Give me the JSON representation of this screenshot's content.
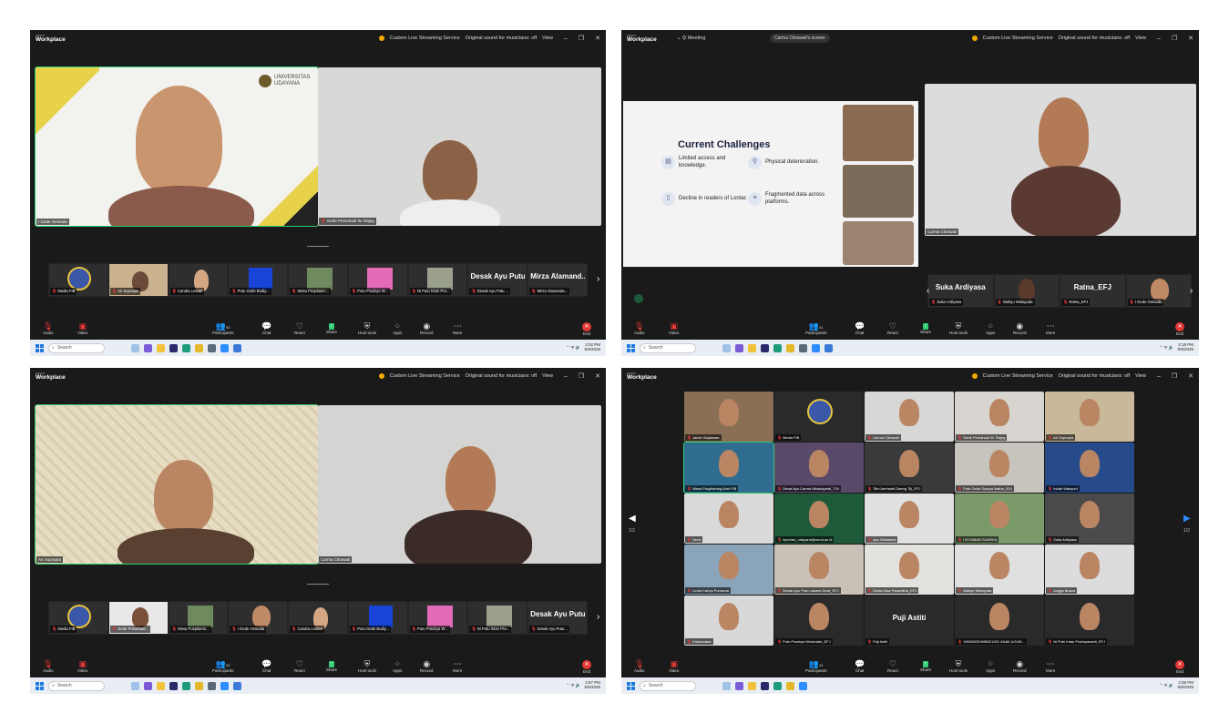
{
  "zoom": {
    "brand_small": "zoom",
    "brand": "Workplace"
  },
  "titlebar": {
    "streaming": "Custom Live Streaming Service",
    "sound": "Original sound for musicians: off",
    "view": "View",
    "meeting": "Meeting",
    "screen_share": "Carma Citrawati's screen"
  },
  "controls": {
    "audio": "Audio",
    "video": "Video",
    "participants": "Participants",
    "participants_count_1": "52",
    "participants_count_2": "41",
    "participants_count_3": "52",
    "participants_count_4": "41",
    "chat": "Chat",
    "react": "React",
    "share": "Share",
    "host_tools": "Host tools",
    "apps": "Apps",
    "record": "Record",
    "more": "More",
    "end": "End"
  },
  "taskbar": {
    "search": "Search"
  },
  "s1": {
    "speaker1": "I Gede Oeinada",
    "speaker2": "Gede Primahadi W. Rajeg",
    "logo_text": "UNIVERSITAS UDAYANA",
    "thumbs": [
      "Media FIB",
      "Ari Suprapta",
      "Candra Lestari",
      "Putu Gede Budiy...",
      "Nissa Puspitanin...",
      "Putu Pradnya W...",
      "Ni Putu Intan Pra...",
      "Desak Ayu Putu ...",
      "Mirza Alamanda..."
    ],
    "big1": "Desak Ayu Putu...",
    "big2": "Mirza Alamand...",
    "time": "2:02 PM",
    "date": "5/9/2025"
  },
  "s2": {
    "slide_title": "Current Challenges",
    "challenges": [
      "Limited access and knowledge.",
      "Physical deterioration.",
      "Decline in readers of Lontar.",
      "Fragmented data across platforms."
    ],
    "speaker": "Carma Citrawati",
    "strip_names": [
      "Suka Ardiyasa",
      "Wahyu Widayuda",
      "Ratna_EFJ",
      "I Gede Oeinada"
    ],
    "big1": "Suka Ardiyasa",
    "big2": "Ratna_EFJ",
    "time": "2:19 PM",
    "date": "5/9/2025"
  },
  "s3": {
    "speaker1": "Ari Suprapta",
    "speaker2": "Carma Citrawati",
    "thumbs": [
      "Media FIB",
      "Gede Primahadi...",
      "Nissa Puspitanin...",
      "I Gede Oeinada",
      "Candra Lestari",
      "Putu Gede Budiy...",
      "Putu Pradnya W...",
      "Ni Putu Intan Pra...",
      "Desak Ayu Putu..."
    ],
    "big": "Desak Ayu Putu...",
    "time": "2:57 PM",
    "date": "5/9/2025"
  },
  "s4": {
    "gallery": [
      "Jamin Saptawan",
      "Media FIB",
      "Carma Citrawati",
      "Gede Primahadi W. Rajeg",
      "Ari Suprapta",
      "Nissa Puspitaning Adni FIB",
      "Dewa Ayu Carma Miradayanti_734",
      "Titin Amrisarti Daeng Tiji_EFJ",
      "Putu Gede Suarya Natha_510",
      "Indah Wahyuni",
      "Sena",
      "nyoman_udayana@unud.ac.id",
      "Ayu Widiastuti",
      "I NYOMAN SUARKA",
      "Suka Ardiyasa",
      "Linda Cahya Purnama",
      "Desak Ayu Putu Laksmi Dewi_EFJ",
      "Dinda Diaz Paramitha_EFJ",
      "Wahyu Widayuda",
      "Angga Buana",
      "Krisnantara",
      "Putu Pradnya Wulandari_EFJ",
      "Puji Astiti",
      "196008251986021001 ANAK AGUN...",
      "Ni Putu Intan Pradnyasanti_EFJ"
    ],
    "big": "Puji Astiti",
    "page_left": "1/2",
    "page_right": "1/2",
    "time": "3:38 PM",
    "date": "5/9/2025"
  },
  "colors": {
    "active": "#2ecc71",
    "end": "#e53935",
    "bg": "#1a1a1a"
  }
}
